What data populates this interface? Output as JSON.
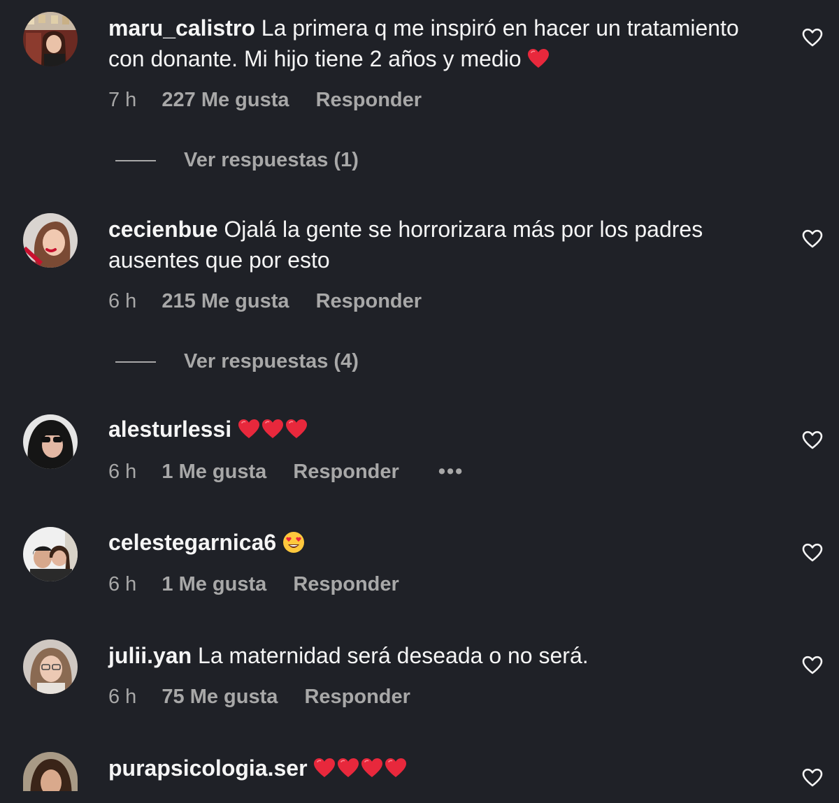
{
  "comments": [
    {
      "username": "maru_calistro",
      "text": "La primera q me inspiró en hacer un tratamiento con donante. Mi hijo tiene 2 años y medio",
      "time": "7 h",
      "likes": "227 Me gusta",
      "reply": "Responder",
      "view_replies": "Ver respuestas (1)"
    },
    {
      "username": "cecienbue",
      "text": "Ojalá la gente se horrorizara más por los padres ausentes que por esto",
      "time": "6 h",
      "likes": "215 Me gusta",
      "reply": "Responder",
      "view_replies": "Ver respuestas (4)"
    },
    {
      "username": "alesturlessi",
      "text": "",
      "time": "6 h",
      "likes": "1 Me gusta",
      "reply": "Responder",
      "more": "•••"
    },
    {
      "username": "celestegarnica6",
      "text": "",
      "time": "6 h",
      "likes": "1 Me gusta",
      "reply": "Responder"
    },
    {
      "username": "julii.yan",
      "text": "La maternidad será deseada o no será.",
      "time": "6 h",
      "likes": "75 Me gusta",
      "reply": "Responder"
    },
    {
      "username": "purapsicologia.ser",
      "text": ""
    }
  ],
  "colors": {
    "background": "#1f2127",
    "primary_text": "#f5f5f5",
    "secondary_text": "#a8a8a8",
    "heart_emoji": "#e8283c"
  },
  "icons": {
    "like": "heart-outline-icon",
    "emoji_heart": "red-heart-emoji",
    "emoji_face": "heart-eyes-emoji",
    "more": "more-options-icon"
  }
}
